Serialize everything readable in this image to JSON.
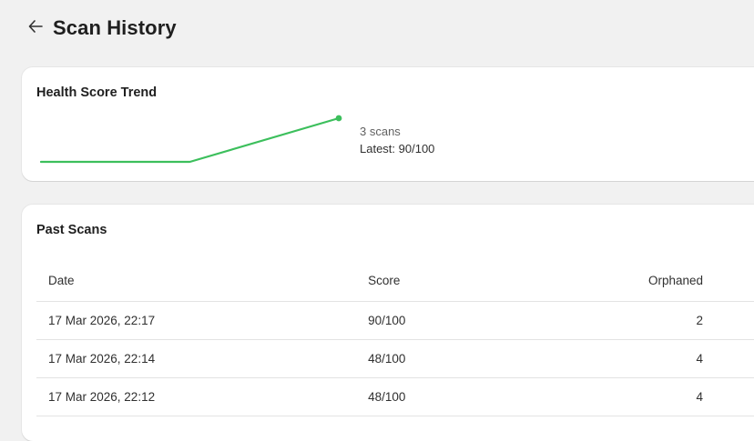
{
  "header": {
    "title": "Scan History",
    "back_icon": "arrow-left-icon"
  },
  "trend": {
    "title": "Health Score Trend",
    "scan_count": "3 scans",
    "latest": "Latest: 90/100",
    "line_color": "#3cbf5c",
    "scores": [
      48,
      48,
      90
    ]
  },
  "past_scans": {
    "title": "Past Scans",
    "columns": [
      "Date",
      "Score",
      "Orphaned"
    ],
    "rows": [
      {
        "date": "17 Mar 2026, 22:17",
        "score": "90/100",
        "orphaned": "2"
      },
      {
        "date": "17 Mar 2026, 22:14",
        "score": "48/100",
        "orphaned": "4"
      },
      {
        "date": "17 Mar 2026, 22:12",
        "score": "48/100",
        "orphaned": "4"
      }
    ]
  }
}
